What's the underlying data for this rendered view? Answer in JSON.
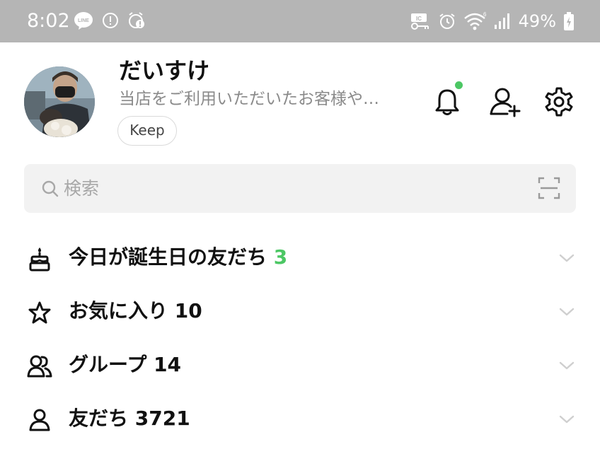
{
  "status_bar": {
    "time": "8:02",
    "battery_percent": "49%",
    "left_icons": [
      "line-icon",
      "info-circle-icon",
      "alarm-sync-icon"
    ],
    "right_icons": [
      "ic-key-icon",
      "alarm-icon",
      "wifi-icon",
      "signal-icon",
      "battery-icon"
    ]
  },
  "profile": {
    "name": "だいすけ",
    "status_message": "当店をご利用いただいたお客様や…",
    "keep_label": "Keep"
  },
  "header_actions": {
    "notification_has_dot": true,
    "icons": [
      "bell-icon",
      "add-friend-icon",
      "gear-icon"
    ]
  },
  "search": {
    "placeholder": "検索"
  },
  "sections": [
    {
      "label": "今日が誕生日の友だち",
      "count": "3",
      "icon": "cake-icon",
      "count_color": "#4cc764"
    },
    {
      "label": "お気に入り",
      "count": "10",
      "icon": "star-icon",
      "count_color": "#111111"
    },
    {
      "label": "グループ",
      "count": "14",
      "icon": "group-icon",
      "count_color": "#111111"
    },
    {
      "label": "友だち",
      "count": "3721",
      "icon": "friend-icon",
      "count_color": "#111111"
    }
  ],
  "colors": {
    "accent_green": "#4cc764",
    "status_bar_bg": "#b5b5b5",
    "search_bg": "#f2f2f2"
  }
}
